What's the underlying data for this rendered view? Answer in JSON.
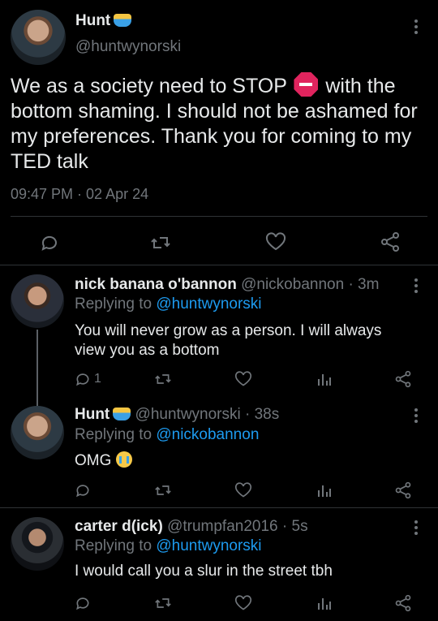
{
  "main_tweet": {
    "display_name": "Hunt",
    "handle": "@huntwynorski",
    "text_before_emoji": "We as a society need to STOP",
    "text_after_emoji": " with the bottom shaming. I should not be ashamed for my preferences. Thank you for coming to my TED talk",
    "timestamp": "09:47 PM · 02 Apr 24"
  },
  "replies": [
    {
      "display_name": "nick banana o'bannon",
      "handle": "@nickobannon",
      "time": "· 3m",
      "replying_label": "Replying to",
      "replying_to": "@huntwynorski",
      "text": "You will never grow as a person. I will always view you as a bottom",
      "reply_count": "1"
    },
    {
      "display_name": "Hunt",
      "handle": "@huntwynorski",
      "time": "· 38s",
      "replying_label": "Replying to",
      "replying_to": "@nickobannon",
      "text": "OMG",
      "reply_count": ""
    },
    {
      "display_name": "carter d(ick)",
      "handle": "@trumpfan2016",
      "time": "· 5s",
      "replying_label": "Replying to",
      "replying_to": "@huntwynorski",
      "text": "I would call you a slur in the street tbh",
      "reply_count": ""
    }
  ],
  "colors": {
    "background": "#000000",
    "text": "#e7e9ea",
    "muted": "#71767b",
    "link": "#1d9bf0",
    "stop_sign": "#e0245e"
  },
  "icons": [
    "reply-icon",
    "retweet-icon",
    "like-icon",
    "share-icon",
    "views-icon",
    "more-icon"
  ]
}
